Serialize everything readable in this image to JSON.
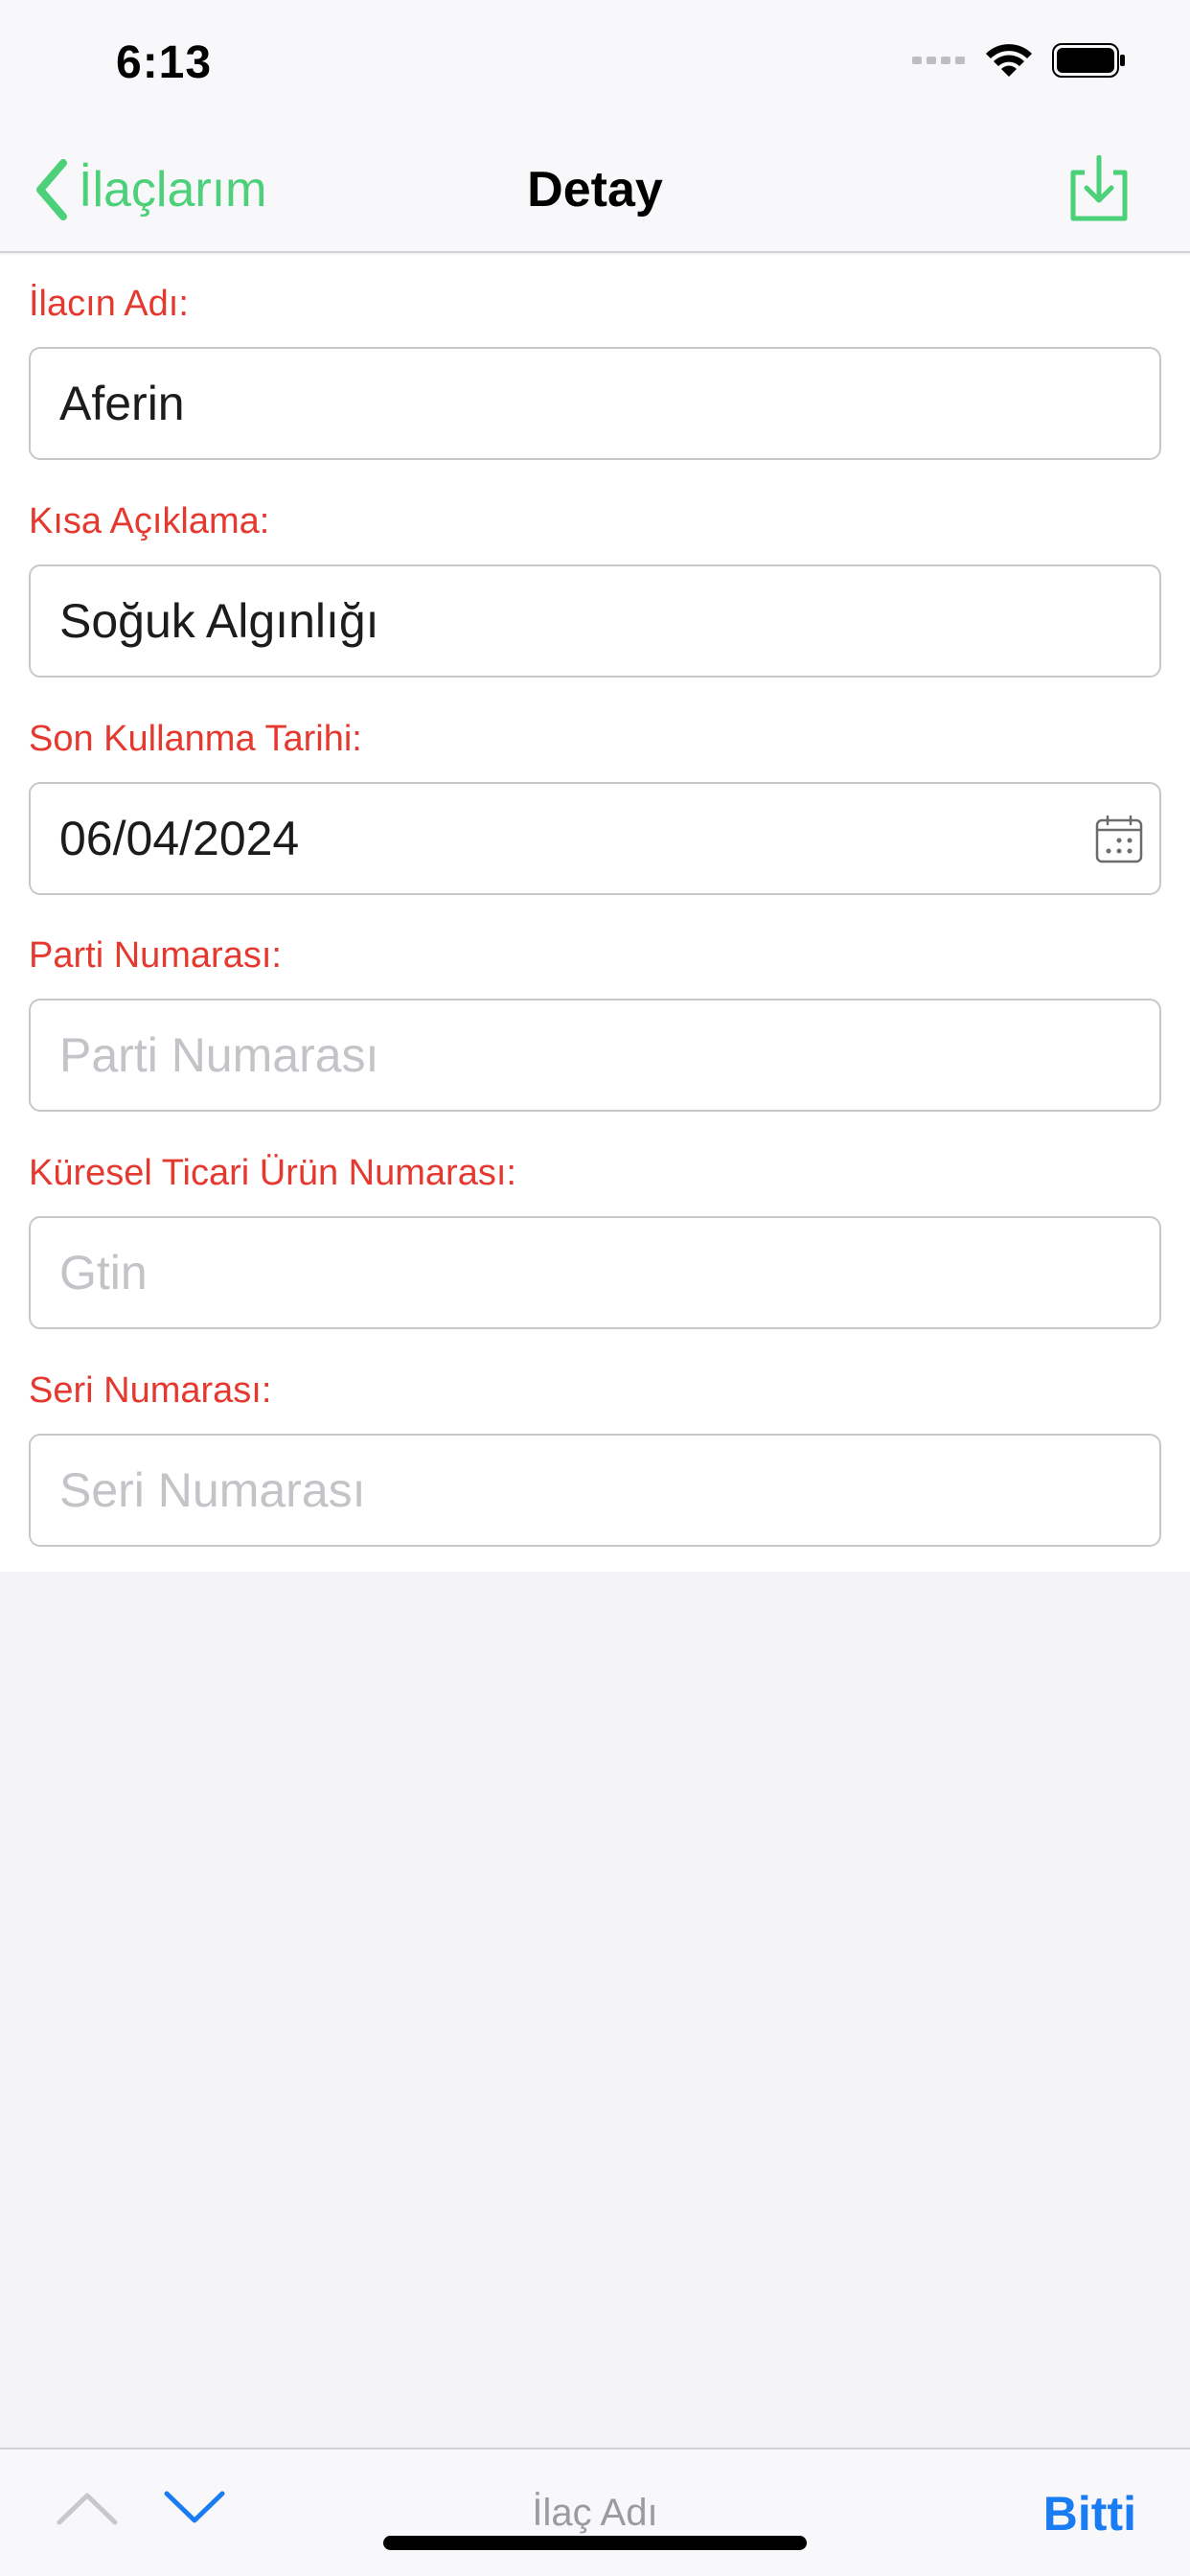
{
  "status_bar": {
    "time": "6:13"
  },
  "nav": {
    "back_label": "İlaçlarım",
    "title": "Detay"
  },
  "form": {
    "fields": [
      {
        "label": "İlacın Adı:",
        "value": "Aferin",
        "placeholder": ""
      },
      {
        "label": "Kısa Açıklama:",
        "value": "Soğuk Algınlığı",
        "placeholder": ""
      },
      {
        "label": "Son Kullanma Tarihi:",
        "value": "06/04/2024",
        "placeholder": ""
      },
      {
        "label": "Parti Numarası:",
        "value": "",
        "placeholder": "Parti Numarası"
      },
      {
        "label": "Küresel Ticari Ürün Numarası:",
        "value": "",
        "placeholder": "Gtin"
      },
      {
        "label": "Seri Numarası:",
        "value": "",
        "placeholder": "Seri Numarası"
      }
    ]
  },
  "toolbar": {
    "current_field": "İlaç Adı",
    "done_label": "Bitti"
  },
  "colors": {
    "accent": "#4cd07a",
    "label": "#e5392f",
    "done": "#1a7cf2"
  },
  "icons": [
    "back-chevron-icon",
    "download-icon",
    "calendar-icon",
    "chevron-up-icon",
    "chevron-down-icon",
    "wifi-icon",
    "battery-icon",
    "signal-icon"
  ]
}
